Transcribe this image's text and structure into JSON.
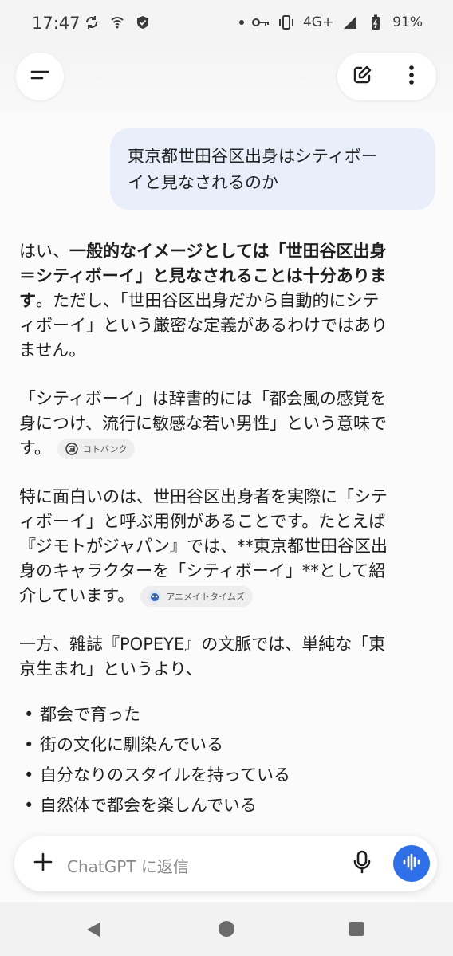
{
  "status_bar": {
    "time": "17:47",
    "network": "4G+",
    "battery": "91%",
    "left_icons": [
      "sync-icon",
      "wifi-calling-icon",
      "shield-icon"
    ],
    "right_icons": [
      "dot-icon",
      "key-icon",
      "vibrate-icon",
      "signal-icon",
      "battery-icon"
    ]
  },
  "header": {
    "menu_icon": "menu-icon",
    "compose_icon": "compose-icon",
    "more_icon": "more-vertical-icon"
  },
  "user_message": {
    "lines": [
      "東京都世田谷区出身はシティボー",
      "イと見なされるのか"
    ]
  },
  "answer": {
    "p1_l1_a": "はい、",
    "p1_l1_b": "一般的なイメージとしては「世田谷区出身",
    "p1_l2_b": "＝シティボーイ」と見なされることは十分ありま",
    "p1_l3_b": "す",
    "p1_l3_rest": "。ただし、「世田谷区出身だから自動的にシテ",
    "p1_l4": "ィボーイ」という厳密な定義があるわけではあり",
    "p1_l5": "ません。",
    "p2_l1": "「シティボーイ」は辞書的には「都会風の感覚を",
    "p2_l2": "身につけ、流行に敏感な若い男性」という意味で",
    "p2_l3": "す。",
    "p2_chip": "コトバンク",
    "p3_l1": "特に面白いのは、世田谷区出身者を実際に「シテ",
    "p3_l2": "ィボーイ」と呼ぶ用例があることです。たとえば",
    "p3_l3": "『ジモトがジャパン』では、**東京都世田谷区出",
    "p3_l4": "身のキャラクターを「シティボーイ」**として紹",
    "p3_l5": "介しています。",
    "p3_chip": "アニメイトタイムズ",
    "p4_l1": "一方、雑誌『POPEYE』の文脈では、単純な「東",
    "p4_l2": "京生まれ」というより、",
    "bullets": [
      "都会で育った",
      "街の文化に馴染んでいる",
      "自分なりのスタイルを持っている",
      "自然体で都会を楽しんでいる"
    ]
  },
  "input": {
    "placeholder": "ChatGPT に返信",
    "plus_icon": "plus-icon",
    "mic_icon": "microphone-icon",
    "voice_icon": "voice-mode-icon"
  },
  "nav": {
    "back_icon": "back-icon",
    "home_icon": "home-icon",
    "recents_icon": "recents-icon"
  },
  "colors": {
    "user_bubble": "#e9eefb",
    "accent_blue": "#2f6fe8",
    "text": "#1f1f1f"
  }
}
